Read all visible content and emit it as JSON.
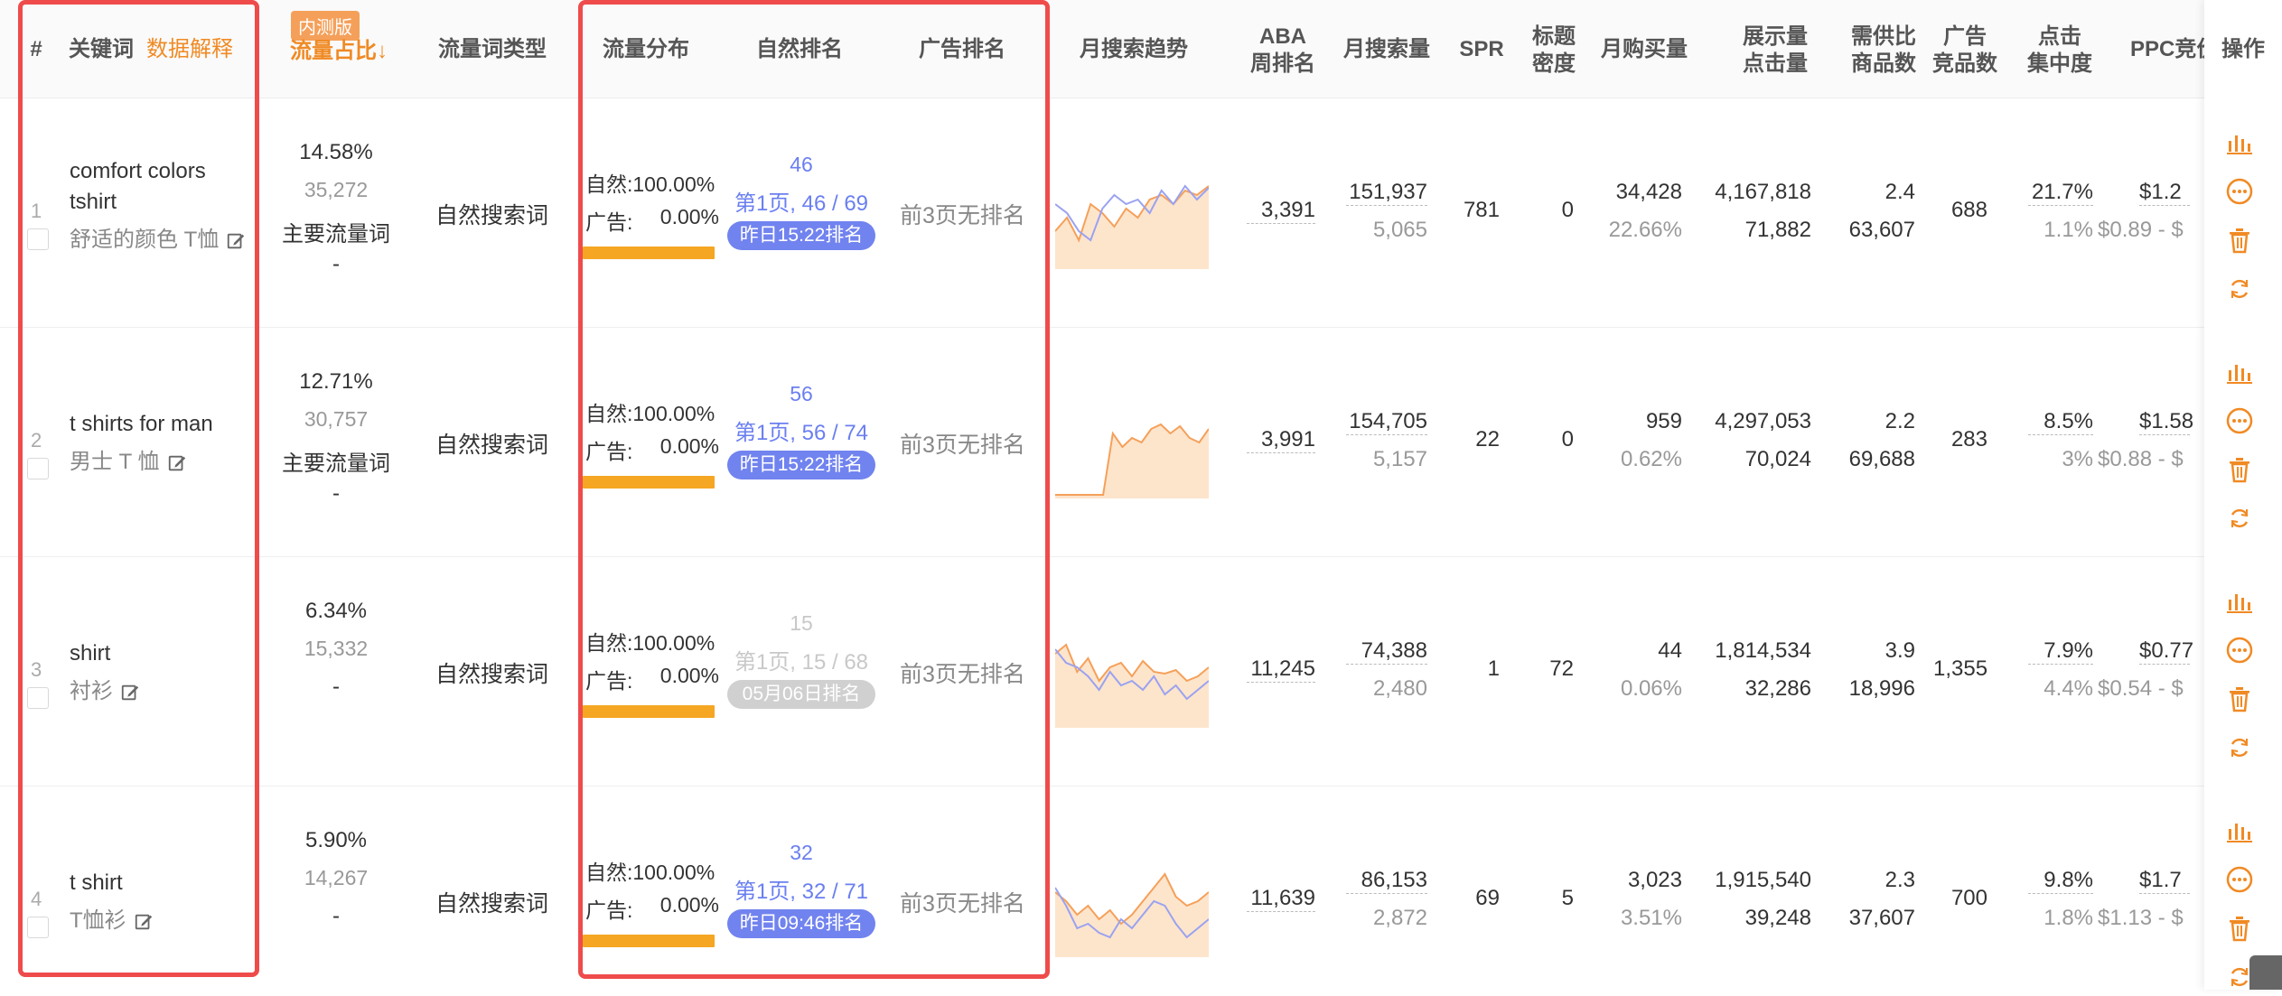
{
  "header": {
    "hash": "#",
    "keyword": "关键词",
    "data_explain": "数据解释",
    "beta_badge": "内测版",
    "traffic_share": "流量占比↓",
    "traffic_type": "流量词类型",
    "flow_dist": "流量分布",
    "natural_rank": "自然排名",
    "ad_rank": "广告排名",
    "monthly_trend": "月搜索趋势",
    "aba_line1": "ABA",
    "aba_line2": "周排名",
    "monthly_search": "月搜索量",
    "spr": "SPR",
    "title_line1": "标题",
    "title_line2": "密度",
    "monthly_buy": "月购买量",
    "impr_line1": "展示量",
    "impr_line2": "点击量",
    "supply_line1": "需供比",
    "supply_line2": "商品数",
    "adcomp_line1": "广告",
    "adcomp_line2": "竞品数",
    "click_line1": "点击",
    "click_line2": "集中度",
    "ppc": "PPC竞价",
    "ops": "操作"
  },
  "colors": {
    "accent_orange": "#f08a24",
    "rank_blue": "#6a7ff0",
    "badge_blue": "#7183ef",
    "badge_gray": "#d0d0d0",
    "flow_bar": "#f5a623",
    "highlight_red": "#ef4b4b"
  },
  "rows": [
    {
      "index": "1",
      "kw_en_line1": "comfort colors",
      "kw_en_line2": "tshirt",
      "kw_zh": "舒适的颜色 T恤",
      "share_pct": "14.58%",
      "share_count": "35,272",
      "share_tag": "主要流量词",
      "share_dash": "-",
      "traffic_type": "自然搜索词",
      "flow_natural": "自然:100.00%",
      "flow_ad_label": "广告:",
      "flow_ad_value": "0.00%",
      "rank_top": "46",
      "rank_mid": "第1页, 46 / 69",
      "rank_badge": "昨日15:22排名",
      "rank_badge_style": "blue",
      "ad_rank": "前3页无排名",
      "aba": "3,391",
      "search_vol": "151,937",
      "search_vol_sub": "5,065",
      "spr": "781",
      "title_density": "0",
      "buy_vol": "34,428",
      "buy_pct": "22.66%",
      "impressions": "4,167,818",
      "clicks": "71,882",
      "supply_ratio": "2.4",
      "products": "63,607",
      "ad_comp": "688",
      "click_conc": "21.7%",
      "click_conc_sub": "1.1%",
      "ppc": "$1.2",
      "ppc_range": "$0.89 - $",
      "trend_orange": [
        40,
        55,
        30,
        70,
        60,
        45,
        65,
        55,
        75,
        80,
        70,
        85,
        80,
        90
      ],
      "trend_blue": [
        70,
        60,
        40,
        30,
        65,
        80,
        70,
        75,
        60,
        85,
        70,
        90,
        75,
        88
      ]
    },
    {
      "index": "2",
      "kw_en_line1": "t shirts for man",
      "kw_en_line2": "",
      "kw_zh": "男士 T 恤",
      "share_pct": "12.71%",
      "share_count": "30,757",
      "share_tag": "主要流量词",
      "share_dash": "-",
      "traffic_type": "自然搜索词",
      "flow_natural": "自然:100.00%",
      "flow_ad_label": "广告:",
      "flow_ad_value": "0.00%",
      "rank_top": "56",
      "rank_mid": "第1页, 56 / 74",
      "rank_badge": "昨日15:22排名",
      "rank_badge_style": "blue",
      "ad_rank": "前3页无排名",
      "aba": "3,991",
      "search_vol": "154,705",
      "search_vol_sub": "5,157",
      "spr": "22",
      "title_density": "0",
      "buy_vol": "959",
      "buy_pct": "0.62%",
      "impressions": "4,297,053",
      "clicks": "70,024",
      "supply_ratio": "2.2",
      "products": "69,688",
      "ad_comp": "283",
      "click_conc": "8.5%",
      "click_conc_sub": "3%",
      "ppc": "$1.58",
      "ppc_range": "$0.88 - $",
      "trend_orange": [
        2,
        2,
        2,
        2,
        2,
        2,
        70,
        55,
        65,
        60,
        75,
        80,
        70,
        78,
        65,
        60,
        75
      ],
      "trend_blue": []
    },
    {
      "index": "3",
      "kw_en_line1": "shirt",
      "kw_en_line2": "",
      "kw_zh": "衬衫",
      "share_pct": "6.34%",
      "share_count": "15,332",
      "share_tag": "",
      "share_dash": "-",
      "traffic_type": "自然搜索词",
      "flow_natural": "自然:100.00%",
      "flow_ad_label": "广告:",
      "flow_ad_value": "0.00%",
      "rank_top": "15",
      "rank_mid": "第1页, 15 / 68",
      "rank_badge": "05月06日排名",
      "rank_badge_style": "gray",
      "ad_rank": "前3页无排名",
      "aba": "11,245",
      "search_vol": "74,388",
      "search_vol_sub": "2,480",
      "spr": "1",
      "title_density": "72",
      "buy_vol": "44",
      "buy_pct": "0.06%",
      "impressions": "1,814,534",
      "clicks": "32,286",
      "supply_ratio": "3.9",
      "products": "18,996",
      "ad_comp": "1,355",
      "click_conc": "7.9%",
      "click_conc_sub": "4.4%",
      "ppc": "$0.77",
      "ppc_range": "$0.54 - $",
      "trend_orange": [
        80,
        90,
        60,
        75,
        50,
        65,
        70,
        55,
        72,
        60,
        58,
        62,
        50,
        55,
        65
      ],
      "trend_blue": [
        85,
        70,
        65,
        55,
        40,
        60,
        45,
        50,
        40,
        55,
        35,
        45,
        30,
        40,
        50
      ]
    },
    {
      "index": "4",
      "kw_en_line1": "t shirt",
      "kw_en_line2": "",
      "kw_zh": "T恤衫",
      "share_pct": "5.90%",
      "share_count": "14,267",
      "share_tag": "",
      "share_dash": "-",
      "traffic_type": "自然搜索词",
      "flow_natural": "自然:100.00%",
      "flow_ad_label": "广告:",
      "flow_ad_value": "0.00%",
      "rank_top": "32",
      "rank_mid": "第1页, 32 / 71",
      "rank_badge": "昨日09:46排名",
      "rank_badge_style": "blue",
      "ad_rank": "前3页无排名",
      "aba": "11,639",
      "search_vol": "86,153",
      "search_vol_sub": "2,872",
      "spr": "69",
      "title_density": "5",
      "buy_vol": "3,023",
      "buy_pct": "3.51%",
      "impressions": "1,915,540",
      "clicks": "39,248",
      "supply_ratio": "2.3",
      "products": "37,607",
      "ad_comp": "700",
      "click_conc": "9.8%",
      "click_conc_sub": "1.8%",
      "ppc": "$1.7",
      "ppc_range": "$1.13 - $",
      "trend_orange": [
        70,
        60,
        45,
        55,
        40,
        50,
        35,
        45,
        60,
        75,
        90,
        65,
        55,
        60,
        70
      ],
      "trend_blue": [
        75,
        55,
        30,
        35,
        25,
        20,
        40,
        30,
        45,
        60,
        55,
        35,
        20,
        30,
        40
      ]
    }
  ]
}
